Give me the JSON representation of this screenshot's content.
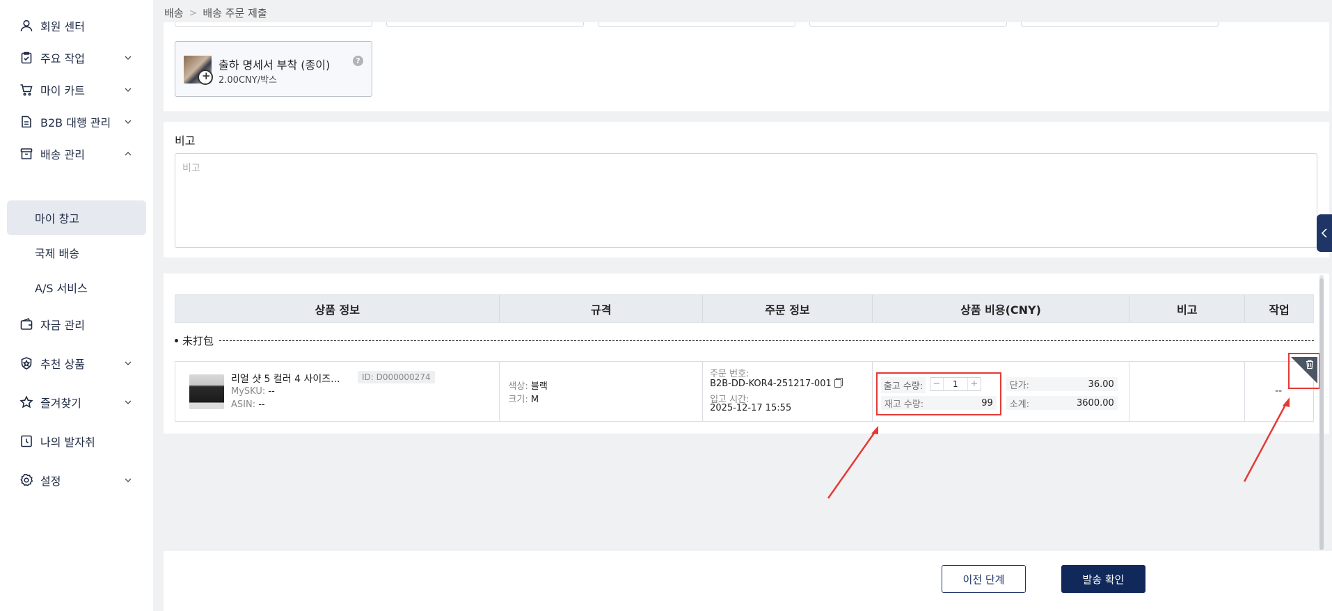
{
  "sidebar": {
    "items": [
      {
        "label": "회원 센터",
        "icon": "user-icon",
        "expandable": false
      },
      {
        "label": "주요 작업",
        "icon": "clipboard-check-icon",
        "expandable": true
      },
      {
        "label": "마이 카트",
        "icon": "cart-icon",
        "expandable": true
      },
      {
        "label": "B2B 대행 관리",
        "icon": "document-icon",
        "expandable": true
      },
      {
        "label": "배송 관리",
        "icon": "box-icon",
        "expandable": true,
        "expanded": true
      },
      {
        "label": "자금 관리",
        "icon": "wallet-icon",
        "expandable": false
      },
      {
        "label": "추천 상품",
        "icon": "badge-star-icon",
        "expandable": true
      },
      {
        "label": "즐겨찾기",
        "icon": "star-icon",
        "expandable": true
      },
      {
        "label": "나의 발자취",
        "icon": "history-icon",
        "expandable": false
      },
      {
        "label": "설정",
        "icon": "gear-icon",
        "expandable": true
      }
    ],
    "sub_items": [
      {
        "label": "마이 창고",
        "active": true
      },
      {
        "label": "국제 배송",
        "active": false
      },
      {
        "label": "A/S 서비스",
        "active": false
      }
    ]
  },
  "breadcrumb": {
    "root": "배송",
    "current": "배송 주문 제출"
  },
  "addon": {
    "title": "출하 명세서 부착 (종이)",
    "price": "2.00CNY/박스",
    "help": "?"
  },
  "remark": {
    "label": "비고",
    "placeholder": "비고",
    "value": ""
  },
  "table": {
    "headers": [
      "상품 정보",
      "규격",
      "주문 정보",
      "상품 비용(CNY)",
      "비고",
      "작업"
    ],
    "group_label": "未打包",
    "rows": [
      {
        "name": "리얼 샷 5 컬러 4 사이즈...",
        "id": "ID: D000000274",
        "mysku_label": "MySKU:",
        "mysku": "--",
        "asin_label": "ASIN:",
        "asin": "--",
        "color_label": "색상:",
        "color": "블랙",
        "size_label": "크기:",
        "size": "M",
        "order_no_label": "주문 번호:",
        "order_no": "B2B-DD-KOR4-251217-001",
        "inbound_label": "입고 시간:",
        "inbound_time": "2025-12-17 15:55",
        "out_qty_label": "출고 수량:",
        "out_qty": "1",
        "stock_label": "재고 수량:",
        "stock": "99",
        "unit_price_label": "단가:",
        "unit_price": "36.00",
        "subtotal_label": "소계:",
        "subtotal": "3600.00",
        "remark": "",
        "action_placeholder": "--"
      }
    ]
  },
  "footer": {
    "prev_label": "이전 단계",
    "confirm_label": "발송 확인"
  },
  "colors": {
    "primary": "#11295a",
    "highlight": "#e53935",
    "header_bg": "#e8ebf0"
  }
}
